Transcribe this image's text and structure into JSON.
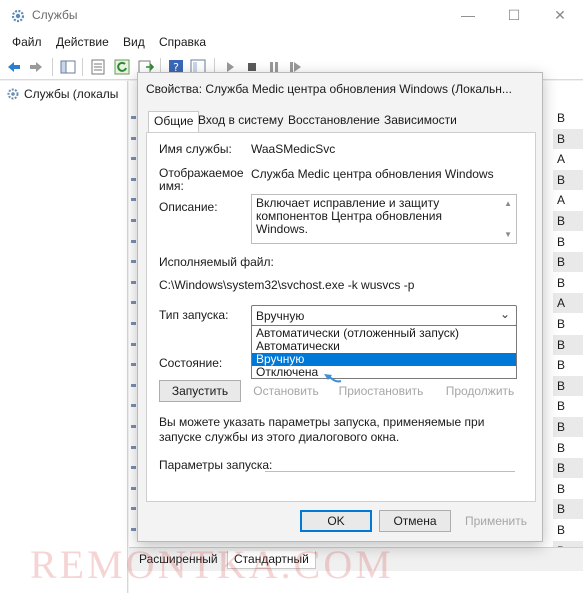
{
  "window": {
    "title": "Службы",
    "icon": "gear-icon",
    "controls": {
      "minimize": "—",
      "maximize": "☐",
      "close": "✕"
    }
  },
  "menu": [
    "Файл",
    "Действие",
    "Вид",
    "Справка"
  ],
  "toolbar_icons": [
    "back-arrow-icon",
    "forward-arrow-icon",
    "console-tree-icon",
    "properties-icon",
    "refresh-icon",
    "export-icon",
    "help-icon",
    "details-icon",
    "play-icon",
    "stop-icon",
    "pause-icon",
    "restart-icon"
  ],
  "tree": {
    "root_label": "Службы (локалы"
  },
  "right_column_letters": [
    "В",
    "В",
    "А",
    "В",
    "А",
    "В",
    "В",
    "В",
    "В",
    "А",
    "В",
    "В",
    "В",
    "В",
    "В",
    "В",
    "В",
    "В",
    "В",
    "В",
    "В",
    "В"
  ],
  "bottom_tabs": [
    "Расширенный",
    "Стандартный"
  ],
  "watermark": "REMONTKA.COM",
  "dialog": {
    "title": "Свойства: Служба Medic центра обновления Windows (Локальн...",
    "tabs": [
      "Общие",
      "Вход в систему",
      "Восстановление",
      "Зависимости"
    ],
    "active_tab": "Общие",
    "service_name_label": "Имя службы:",
    "service_name": "WaaSMedicSvc",
    "display_name_label": "Отображаемое имя:",
    "display_name": "Служба Medic центра обновления Windows",
    "description_label": "Описание:",
    "description": "Включает исправление и защиту компонентов Центра обновления Windows.",
    "exe_label": "Исполняемый файл:",
    "exe_path": "C:\\Windows\\system32\\svchost.exe -k wusvcs -p",
    "startup_type_label": "Тип запуска:",
    "startup_type_value": "Вручную",
    "startup_options": [
      "Автоматически (отложенный запуск)",
      "Автоматически",
      "Вручную",
      "Отключена"
    ],
    "selected_option_index": 2,
    "status_label": "Состояние:",
    "buttons": {
      "start": "Запустить",
      "stop": "Остановить",
      "pause": "Приостановить",
      "resume": "Продолжить"
    },
    "hint": "Вы можете указать параметры запуска, применяемые при запуске службы из этого диалогового окна.",
    "params_label": "Параметры запуска:",
    "footer": {
      "ok": "OK",
      "cancel": "Отмена",
      "apply": "Применить"
    }
  },
  "colors": {
    "selection": "#0078d7",
    "arrow": "#3f8fd8"
  }
}
